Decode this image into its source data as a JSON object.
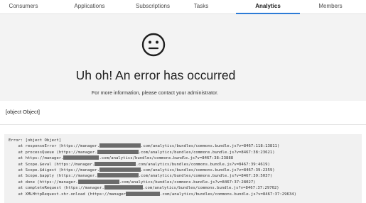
{
  "tabs": [
    {
      "label": "Consumers",
      "active": false
    },
    {
      "label": "Applications",
      "active": false
    },
    {
      "label": "Subscriptions",
      "active": false
    },
    {
      "label": "Tasks",
      "active": false
    },
    {
      "label": "Analytics",
      "active": true
    },
    {
      "label": "Members",
      "active": false
    }
  ],
  "error": {
    "icon": "neutral-face-icon",
    "title": "Uh oh! An error has occurred",
    "subtitle": "For more information, please contact your administrator."
  },
  "object_text": "[object Object]",
  "stack_trace": [
    {
      "a": "Error: [object Object]",
      "b": ""
    },
    {
      "a": "    at responseError (https://manager.",
      "b": ".com/analytics/bundles/commons.bundle.js?v=8467:118:13811)"
    },
    {
      "a": "    at processQueue (https://manager.",
      "b": ".com/analytics/bundles/commons.bundle.js?v=8467:38:23621)"
    },
    {
      "a": "    at https://manager.",
      "b": ".com/analytics/bundles/commons.bundle.js?v=8467:38:23888"
    },
    {
      "a": "    at Scope.$eval (https://manager.",
      "b": ".com/analytics/bundles/commons.bundle.js?v=8467:39:4619)"
    },
    {
      "a": "    at Scope.$digest (https://manager.",
      "b": ".com/analytics/bundles/commons.bundle.js?v=8467:39:2359)"
    },
    {
      "a": "    at Scope.$apply (https://manager.",
      "b": ".com/analytics/bundles/commons.bundle.js?v=8467:39:5037)"
    },
    {
      "a": "    at done (https://manager.",
      "b": ".com/analytics/bundles/commons.bundle.js?v=8467:37:28027)"
    },
    {
      "a": "    at completeRequest (https://manager.",
      "b": ".com/analytics/bundles/commons.bundle.js?v=8467:37:29702)"
    },
    {
      "a": "    at XMLHttpRequest.xhr.onload (https://manager",
      "b": ".com/analytics/bundles/commons.bundle.js?v=8467:37:29634)"
    }
  ],
  "colors": {
    "accent": "#2c7bd6",
    "panel_background": "#f3f3f3",
    "redaction": "#6b6b6b"
  }
}
